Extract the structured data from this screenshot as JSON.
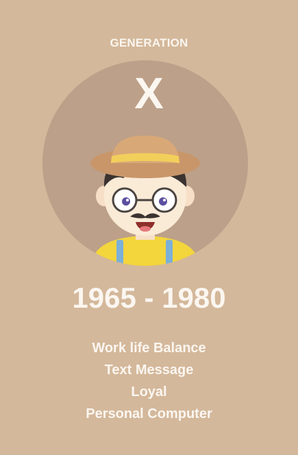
{
  "generation": {
    "label": "GENERATION",
    "letter": "X",
    "years": "1965 - 1980"
  },
  "traits": [
    "Work life Balance",
    "Text Message",
    "Loyal",
    "Personal Computer"
  ],
  "illustration": {
    "icon": "boy-with-hat-and-glasses-illustration",
    "colors": {
      "background": "#d4b89b",
      "circle": "#bca089",
      "text": "#fbf6f0",
      "hat": "#d9a877",
      "shirt": "#f3d53c",
      "suspenders": "#7bb0d8"
    }
  }
}
